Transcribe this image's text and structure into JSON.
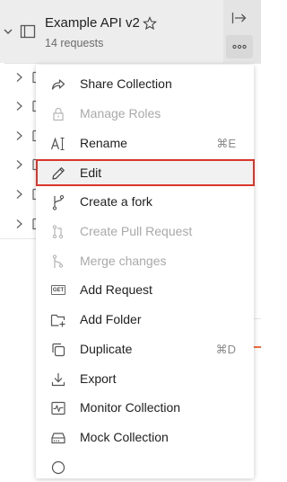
{
  "collection": {
    "name": "Example API v2",
    "request_count": "14 requests"
  },
  "colors": {
    "highlight_border": "#d9362b",
    "accent": "#f26b3a",
    "header_bg": "#ededed"
  },
  "menu": {
    "items": [
      {
        "label": "Share Collection",
        "icon": "share-icon",
        "enabled": true
      },
      {
        "label": "Manage Roles",
        "icon": "lock-icon",
        "enabled": false
      },
      {
        "label": "Rename",
        "icon": "rename-text-icon",
        "enabled": true,
        "shortcut": "⌘E"
      },
      {
        "label": "Edit",
        "icon": "pencil-icon",
        "enabled": true,
        "highlighted": true
      },
      {
        "label": "Create a fork",
        "icon": "fork-icon",
        "enabled": true
      },
      {
        "label": "Create Pull Request",
        "icon": "pull-request-icon",
        "enabled": false
      },
      {
        "label": "Merge changes",
        "icon": "merge-icon",
        "enabled": false
      },
      {
        "label": "Add Request",
        "icon": "get-request-icon",
        "badge": "GET",
        "enabled": true
      },
      {
        "label": "Add Folder",
        "icon": "add-folder-icon",
        "enabled": true
      },
      {
        "label": "Duplicate",
        "icon": "duplicate-icon",
        "enabled": true,
        "shortcut": "⌘D"
      },
      {
        "label": "Export",
        "icon": "export-icon",
        "enabled": true
      },
      {
        "label": "Monitor Collection",
        "icon": "monitor-icon",
        "enabled": true
      },
      {
        "label": "Mock Collection",
        "icon": "mock-server-icon",
        "enabled": true
      }
    ]
  }
}
